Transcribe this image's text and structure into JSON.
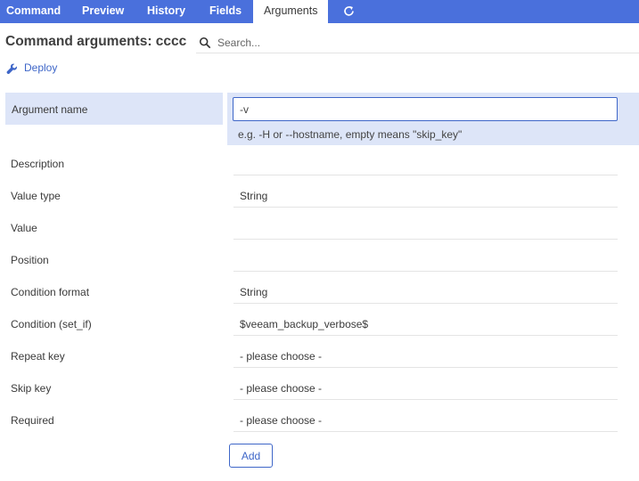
{
  "tabs": {
    "command": "Command",
    "preview": "Preview",
    "history": "History",
    "fields": "Fields",
    "arguments": "Arguments",
    "refresh_icon": "refresh-icon"
  },
  "header": {
    "title": "Command arguments: cccc",
    "search_placeholder": "Search..."
  },
  "actions": {
    "deploy_label": "Deploy",
    "deploy_icon": "wrench-icon"
  },
  "form": {
    "argument_name": {
      "label": "Argument name",
      "value": "-v",
      "hint": "e.g. -H or --hostname, empty means \"skip_key\""
    },
    "fields": [
      {
        "label": "Description",
        "value": ""
      },
      {
        "label": "Value type",
        "value": "String"
      },
      {
        "label": "Value",
        "value": ""
      },
      {
        "label": "Position",
        "value": ""
      },
      {
        "label": "Condition format",
        "value": "String"
      },
      {
        "label": "Condition (set_if)",
        "value": "$veeam_backup_verbose$"
      },
      {
        "label": "Repeat key",
        "value": "- please choose -"
      },
      {
        "label": "Skip key",
        "value": "- please choose -"
      },
      {
        "label": "Required",
        "value": "- please choose -"
      }
    ],
    "add_label": "Add"
  },
  "colors": {
    "accent": "#4a70dc",
    "link": "#3e66c8",
    "active_row": "#dde5f8"
  }
}
